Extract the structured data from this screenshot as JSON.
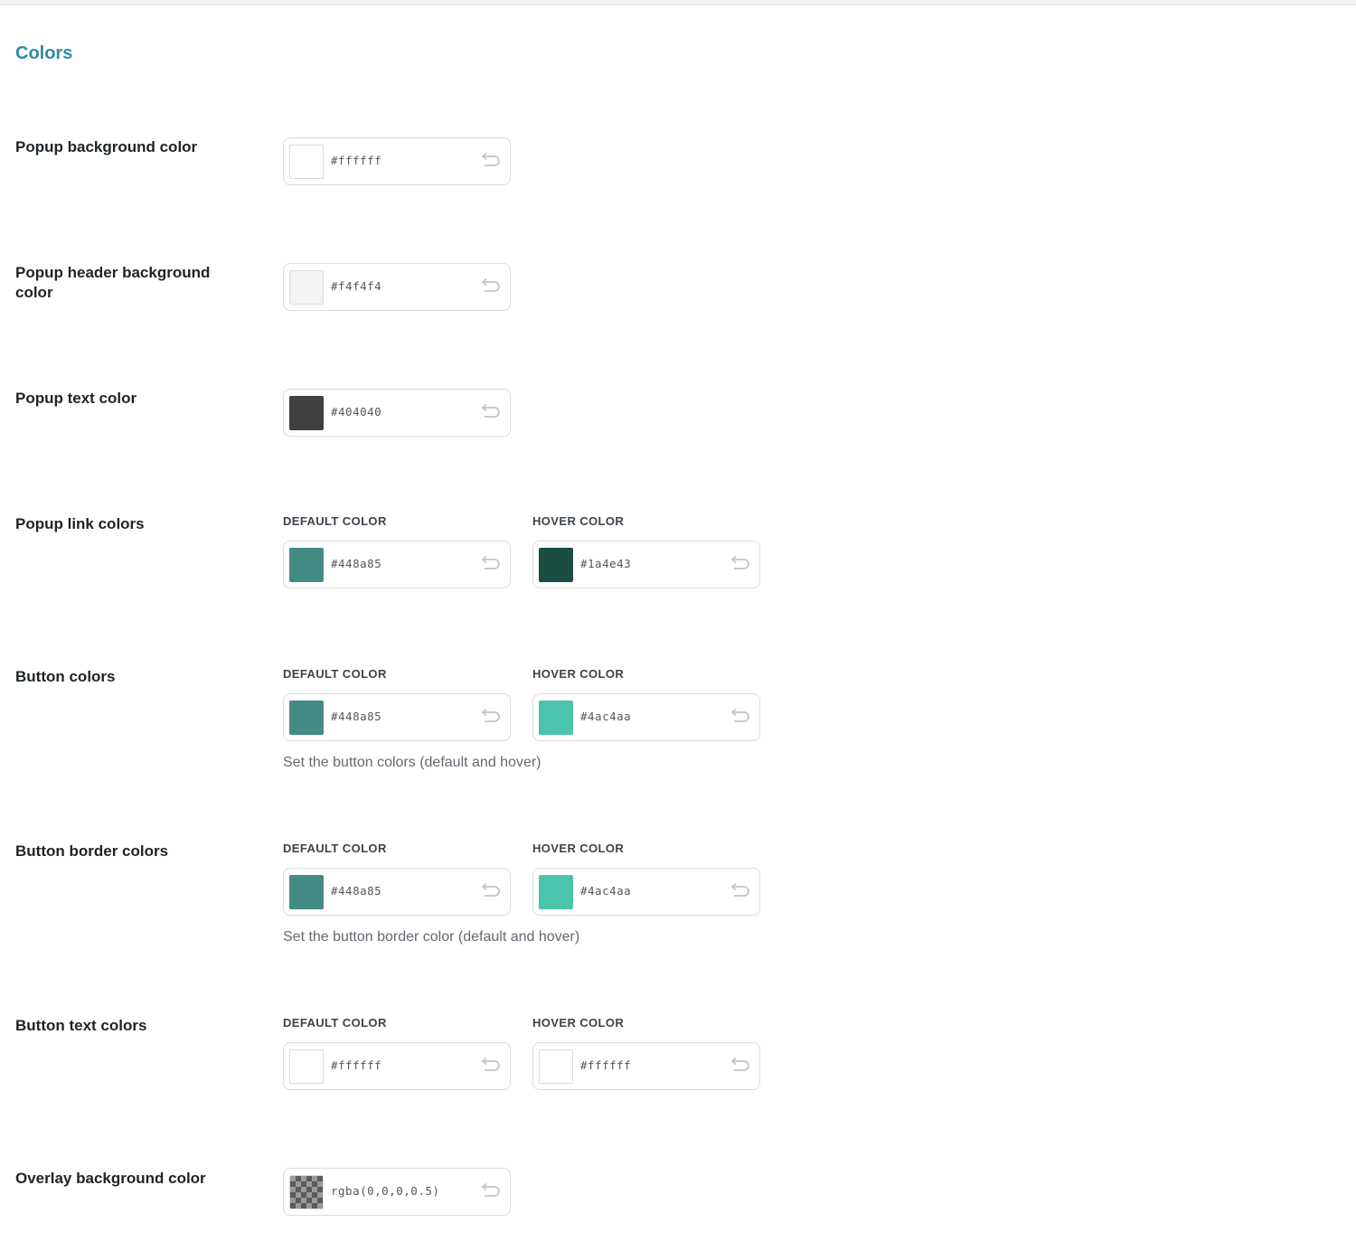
{
  "section_title": "Colors",
  "sub_labels": {
    "default": "DEFAULT COLOR",
    "hover": "HOVER COLOR"
  },
  "rows": [
    {
      "label": "Popup background color",
      "default": {
        "value": "#ffffff",
        "swatch": "#ffffff"
      }
    },
    {
      "label": "Popup header background color",
      "default": {
        "value": "#f4f4f4",
        "swatch": "#f4f4f4"
      }
    },
    {
      "label": "Popup text color",
      "default": {
        "value": "#404040",
        "swatch": "#404040"
      }
    },
    {
      "label": "Popup link colors",
      "default": {
        "value": "#448a85",
        "swatch": "#448a85"
      },
      "hover": {
        "value": "#1a4e43",
        "swatch": "#1a4e43"
      }
    },
    {
      "label": "Button colors",
      "default": {
        "value": "#448a85",
        "swatch": "#448a85"
      },
      "hover": {
        "value": "#4ac4aa",
        "swatch": "#4ac4aa"
      },
      "help": "Set the button colors (default and hover)"
    },
    {
      "label": "Button border colors",
      "default": {
        "value": "#448a85",
        "swatch": "#448a85"
      },
      "hover": {
        "value": "#4ac4aa",
        "swatch": "#4ac4aa"
      },
      "help": "Set the button border color (default and hover)"
    },
    {
      "label": "Button text colors",
      "default": {
        "value": "#ffffff",
        "swatch": "#ffffff"
      },
      "hover": {
        "value": "#ffffff",
        "swatch": "#ffffff"
      }
    },
    {
      "label": "Overlay background color",
      "default": {
        "value": "rgba(0,0,0,0.5)",
        "swatch": "rgba(0,0,0,0.5)"
      }
    }
  ],
  "icons": {
    "reset": "undo-icon",
    "overlay_swatch": "checkerboard-transparency"
  },
  "colors": {
    "accent": "#2e8ba6"
  }
}
